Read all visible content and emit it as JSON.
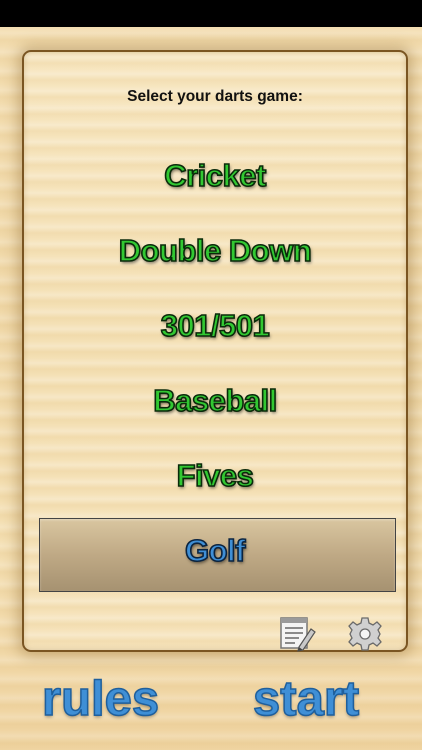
{
  "title": "Select your darts game:",
  "games": [
    {
      "label": "Cricket"
    },
    {
      "label": "Double Down"
    },
    {
      "label": "301/501"
    },
    {
      "label": "Baseball"
    },
    {
      "label": "Fives"
    },
    {
      "label": "Golf",
      "selected": true
    }
  ],
  "icons": {
    "notes": "notes-edit-icon",
    "settings": "gear-icon"
  },
  "bottom": {
    "rules_label": "rules",
    "start_label": "start"
  },
  "colors": {
    "game_text": "#32c832",
    "selected_text": "#3f8fd6",
    "bottom_text": "#3f8fd6"
  }
}
